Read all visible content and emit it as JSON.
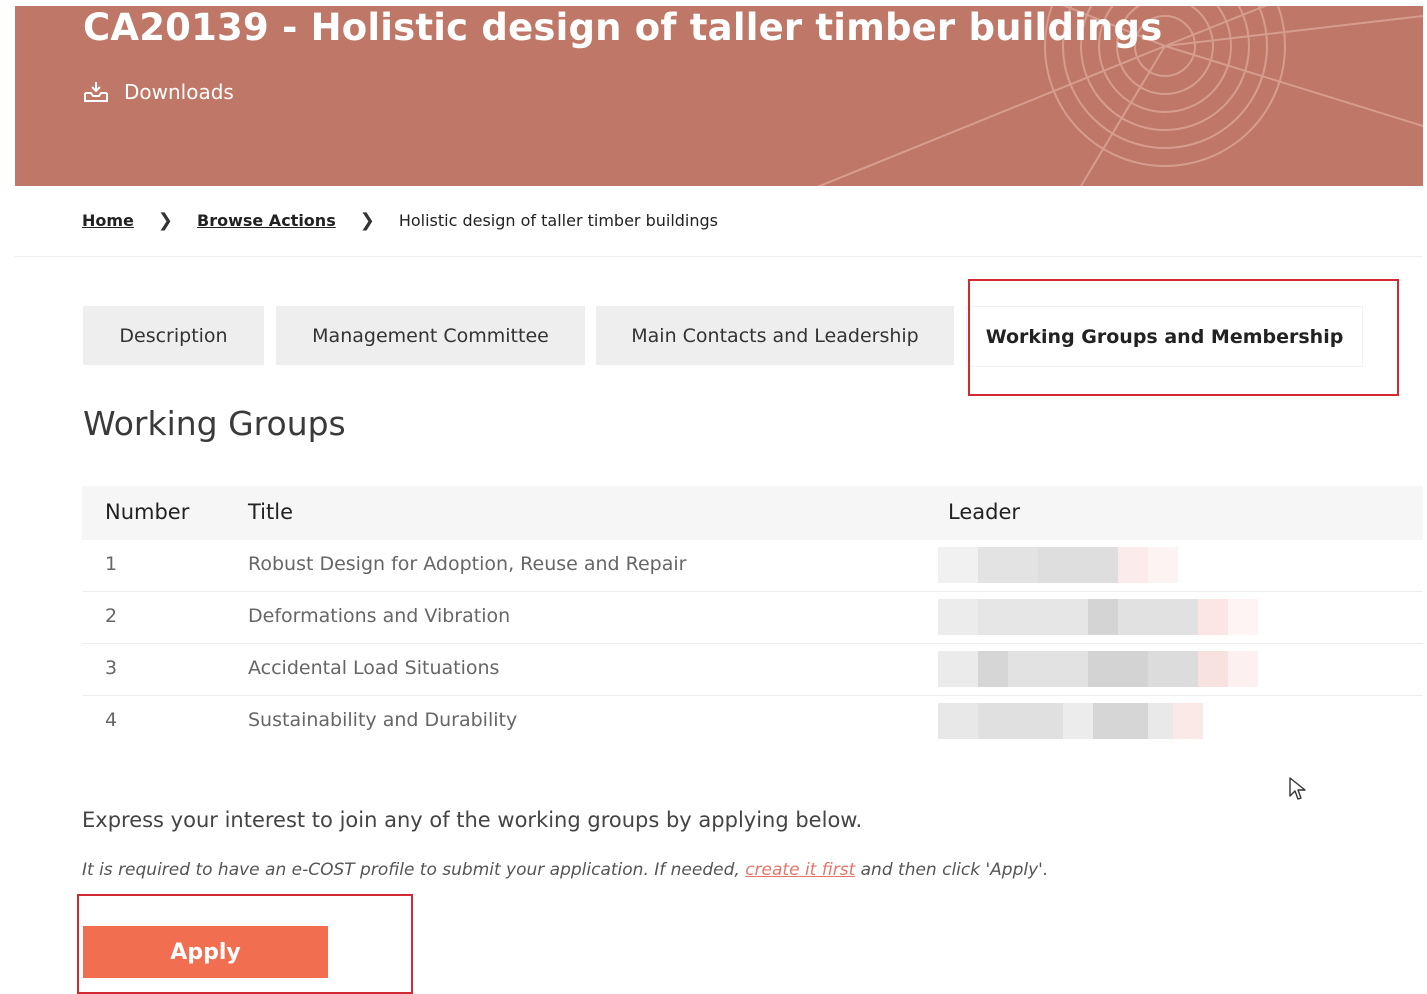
{
  "header": {
    "title": "CA20139 - Holistic design of taller timber buildings",
    "downloads_label": "Downloads",
    "background_color": "#bf7767"
  },
  "breadcrumb": {
    "items": [
      "Home",
      "Browse Actions",
      "Holistic design of taller timber buildings"
    ],
    "separator": ">"
  },
  "tabs": [
    {
      "label": "Description",
      "active": false
    },
    {
      "label": "Management Committee",
      "active": false
    },
    {
      "label": "Main Contacts and Leadership",
      "active": false
    },
    {
      "label": "Working Groups and Membership",
      "active": true
    }
  ],
  "working_groups": {
    "heading": "Working Groups",
    "columns": [
      "Number",
      "Title",
      "Leader"
    ],
    "rows": [
      {
        "number": "1",
        "title": "Robust Design for Adoption, Reuse and Repair",
        "leader": ""
      },
      {
        "number": "2",
        "title": "Deformations and Vibration",
        "leader": ""
      },
      {
        "number": "3",
        "title": "Accidental Load Situations",
        "leader": ""
      },
      {
        "number": "4",
        "title": "Sustainability and Durability",
        "leader": ""
      }
    ]
  },
  "apply_section": {
    "interest_text": "Express your interest to join any of the working groups by applying below.",
    "required_prefix": "It is required to have an e-COST profile to submit your application. If needed, ",
    "create_link": "create it first",
    "required_suffix": " and then click 'Apply'.",
    "apply_label": "Apply",
    "accent_color": "#f26e50",
    "highlight_color": "#d22a32"
  },
  "icons": {
    "downloads": "download-tray-icon",
    "breadcrumb_separator": "chevron-right-icon",
    "cursor": "mouse-pointer-icon"
  }
}
